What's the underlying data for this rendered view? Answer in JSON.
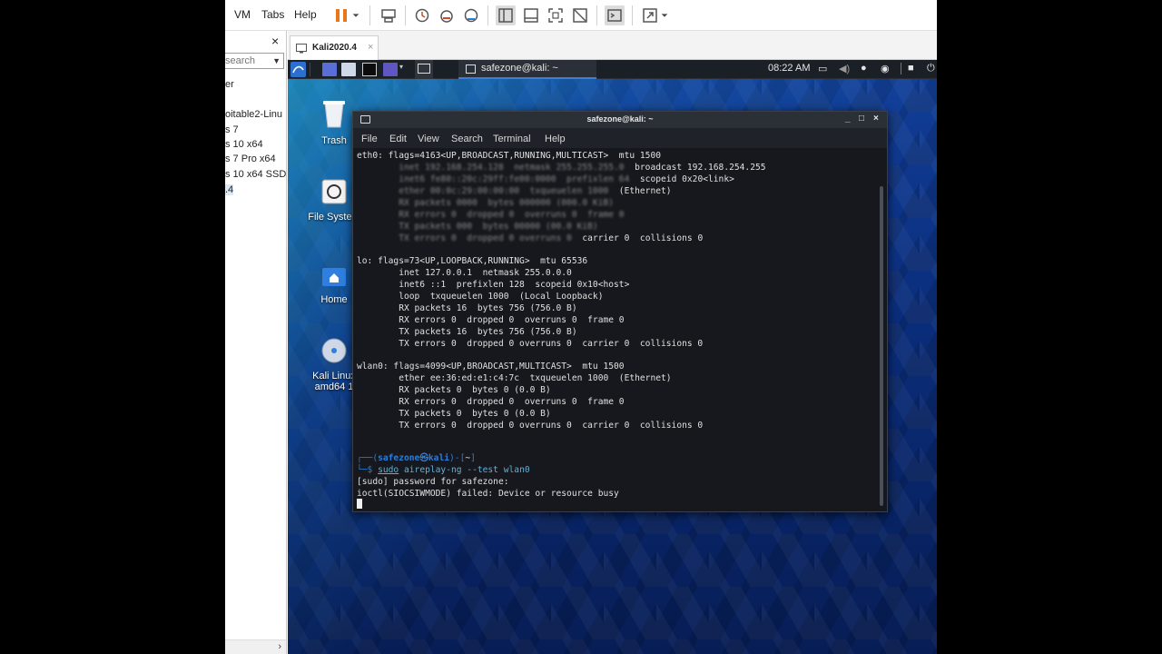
{
  "host": {
    "menu": [
      "VM",
      "Tabs",
      "Help"
    ],
    "library": {
      "close": "×",
      "search_placeholder": "search",
      "items": [
        "er",
        "oitable2-Linu",
        "s 7",
        "s 10 x64",
        "s 7 Pro x64",
        "s 10 x64 SSD",
        ".4"
      ]
    },
    "vm_tab": {
      "label": "Kali2020.4",
      "close": "×"
    }
  },
  "guest": {
    "panel": {
      "task_label": "safezone@kali: ~",
      "clock": "08:22 AM"
    },
    "desktop_icons": [
      {
        "label": "Trash"
      },
      {
        "label": "File System"
      },
      {
        "label": "Home"
      },
      {
        "label": "Kali Linux"
      },
      {
        "label": "amd64 1"
      }
    ],
    "terminal": {
      "title": "safezone@kali: ~",
      "window_controls": [
        "_",
        "□",
        "×"
      ],
      "menu": [
        "File",
        "Edit",
        "View",
        "Search",
        "Terminal",
        "Help"
      ],
      "lines": {
        "l0": "eth0: flags=4163<UP,BROADCAST,RUNNING,MULTICAST>  mtu 1500",
        "l1a": "        inet 192.168.254.128  netmask 255.255.255.0",
        "l1b": "  broadcast 192.168.254.255",
        "l2a": "        inet6 fe80::20c:29ff:fe00:0000  prefixlen 64",
        "l2b": "  scopeid 0x20<link>",
        "l3a": "        ether 00:0c:29:00:00:00  txqueuelen 1000",
        "l3b": "  (Ethernet)",
        "l4": "        RX packets 0000  bytes 000000 (000.0 KiB)",
        "l5": "        RX errors 0  dropped 0  overruns 0  frame 0",
        "l6": "        TX packets 000  bytes 00000 (00.0 KiB)",
        "l7a": "        TX errors 0  dropped 0 overruns 0",
        "l7b": "  carrier 0  collisions 0",
        "lo0": "lo: flags=73<UP,LOOPBACK,RUNNING>  mtu 65536",
        "lo1": "        inet 127.0.0.1  netmask 255.0.0.0",
        "lo2": "        inet6 ::1  prefixlen 128  scopeid 0x10<host>",
        "lo3": "        loop  txqueuelen 1000  (Local Loopback)",
        "lo4": "        RX packets 16  bytes 756 (756.0 B)",
        "lo5": "        RX errors 0  dropped 0  overruns 0  frame 0",
        "lo6": "        TX packets 16  bytes 756 (756.0 B)",
        "lo7": "        TX errors 0  dropped 0 overruns 0  carrier 0  collisions 0",
        "w0": "wlan0: flags=4099<UP,BROADCAST,MULTICAST>  mtu 1500",
        "w1": "        ether ee:36:ed:e1:c4:7c  txqueuelen 1000  (Ethernet)",
        "w2": "        RX packets 0  bytes 0 (0.0 B)",
        "w3": "        RX errors 0  dropped 0  overruns 0  frame 0",
        "w4": "        TX packets 0  bytes 0 (0.0 B)",
        "w5": "        TX errors 0  dropped 0 overruns 0  carrier 0  collisions 0",
        "prompt_open": "┌──(",
        "prompt_user": "safezone㉿kali",
        "prompt_mid": ")-[",
        "prompt_dir": "~",
        "prompt_close": "]",
        "prompt2": "└─$ ",
        "cmd_sudo": "sudo",
        "cmd_rest": " aireplay-ng --test wlan0",
        "out1": "[sudo] password for safezone:",
        "out2": "ioctl(SIOCSIWMODE) failed: Device or resource busy"
      }
    }
  },
  "colors": {
    "terminal_bg": "#16181d",
    "prompt_blue": "#2c7dd9",
    "command_cyan": "#5fb3d9",
    "pause_orange": "#e8771c"
  }
}
